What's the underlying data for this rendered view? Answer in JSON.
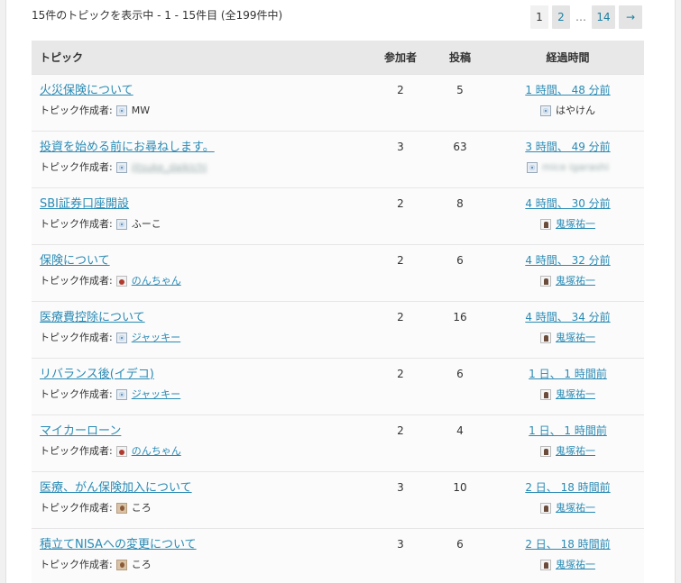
{
  "summary": "15件のトピックを表示中 - 1 - 15件目 (全199件中)",
  "pagination": {
    "pages": [
      "1",
      "2"
    ],
    "ellipsis": "…",
    "last": "14",
    "next": "→"
  },
  "columns": {
    "topic": "トピック",
    "voices": "参加者",
    "posts": "投稿",
    "freshness": "経過時間"
  },
  "author_label": "トピック作成者:",
  "topics": [
    {
      "title": "火災保険について",
      "author": "MW",
      "author_avatar": "gear-icon",
      "author_link": false,
      "voices": "2",
      "posts": "5",
      "freshness": "1 時間、 48 分前",
      "last_by": "はやけん",
      "last_avatar": "gear-icon",
      "last_link": false
    },
    {
      "title": "投資を始める前にお尋ねします。",
      "author": "jitsuke_daikichi",
      "author_avatar": "gear-icon",
      "author_link": true,
      "author_blurred": true,
      "voices": "3",
      "posts": "63",
      "freshness": "3 時間、 49 分前",
      "last_by": "mice igarashi",
      "last_avatar": "gear-icon",
      "last_link": false,
      "last_blurred": true
    },
    {
      "title": "SBI証券口座開設",
      "author": "ふーこ",
      "author_avatar": "gear-icon",
      "author_link": false,
      "voices": "2",
      "posts": "8",
      "freshness": "4 時間、 30 分前",
      "last_by": "鬼塚祐一",
      "last_avatar": "person-icon",
      "last_link": true
    },
    {
      "title": "保険について",
      "author": "のんちゃん",
      "author_avatar": "photo-red",
      "author_link": true,
      "voices": "2",
      "posts": "6",
      "freshness": "4 時間、 32 分前",
      "last_by": "鬼塚祐一",
      "last_avatar": "person-icon",
      "last_link": true
    },
    {
      "title": "医療費控除について",
      "author": "ジャッキー",
      "author_avatar": "gear-icon",
      "author_link": true,
      "voices": "2",
      "posts": "16",
      "freshness": "4 時間、 34 分前",
      "last_by": "鬼塚祐一",
      "last_avatar": "person-icon",
      "last_link": true
    },
    {
      "title": "リバランス後(イデコ)",
      "author": "ジャッキー",
      "author_avatar": "gear-icon",
      "author_link": true,
      "voices": "2",
      "posts": "6",
      "freshness": "1 日、 1 時間前",
      "last_by": "鬼塚祐一",
      "last_avatar": "person-icon",
      "last_link": true
    },
    {
      "title": "マイカーローン",
      "author": "のんちゃん",
      "author_avatar": "photo-red",
      "author_link": true,
      "voices": "2",
      "posts": "4",
      "freshness": "1 日、 1 時間前",
      "last_by": "鬼塚祐一",
      "last_avatar": "person-icon",
      "last_link": true
    },
    {
      "title": "医療、がん保険加入について",
      "author": "ころ",
      "author_avatar": "photo-brown",
      "author_link": false,
      "voices": "3",
      "posts": "10",
      "freshness": "2 日、 18 時間前",
      "last_by": "鬼塚祐一",
      "last_avatar": "person-icon",
      "last_link": true
    },
    {
      "title": "積立てNISAへの変更について",
      "author": "ころ",
      "author_avatar": "photo-brown",
      "author_link": false,
      "voices": "3",
      "posts": "6",
      "freshness": "2 日、 18 時間前",
      "last_by": "鬼塚祐一",
      "last_avatar": "person-icon",
      "last_link": true
    }
  ]
}
